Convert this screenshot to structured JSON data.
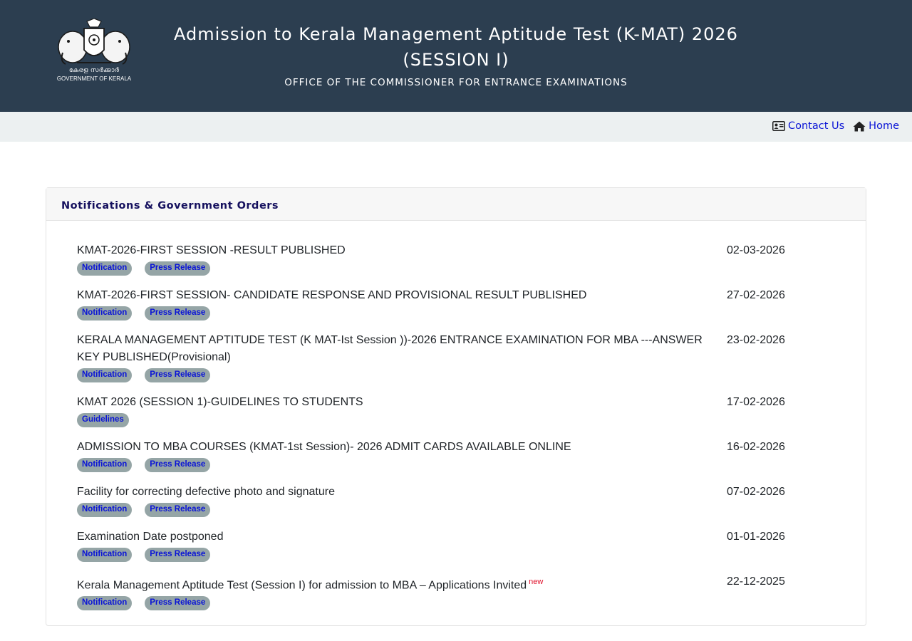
{
  "header": {
    "logo_text_ml": "കേരള സർക്കാർ",
    "logo_text_en": "GOVERNMENT OF KERALA",
    "title_line1": "Admission to Kerala Management Aptitude Test (K-MAT) 2026",
    "title_line2": "(SESSION I)",
    "subtitle": "OFFICE OF THE COMMISSIONER FOR ENTRANCE EXAMINATIONS"
  },
  "nav": {
    "contact_label": "Contact Us",
    "home_label": "Home"
  },
  "card": {
    "title": "Notifications & Government Orders"
  },
  "notifications": [
    {
      "title": "KMAT-2026-FIRST SESSION -RESULT PUBLISHED",
      "date": "02-03-2026",
      "tags": [
        "Notification",
        "Press Release"
      ],
      "new": ""
    },
    {
      "title": "KMAT-2026-FIRST SESSION- CANDIDATE RESPONSE AND PROVISIONAL RESULT PUBLISHED",
      "date": "27-02-2026",
      "tags": [
        "Notification",
        "Press Release"
      ],
      "new": ""
    },
    {
      "title": "KERALA MANAGEMENT APTITUDE TEST (K MAT-Ist Session ))-2026 ENTRANCE EXAMINATION FOR MBA ---ANSWER KEY PUBLISHED(Provisional)",
      "date": "23-02-2026",
      "tags": [
        "Notification",
        "Press Release"
      ],
      "new": ""
    },
    {
      "title": "KMAT 2026 (SESSION 1)-GUIDELINES TO STUDENTS",
      "date": "17-02-2026",
      "tags": [
        "Guidelines"
      ],
      "new": ""
    },
    {
      "title": "ADMISSION TO MBA COURSES (KMAT-1st Session)- 2026 ADMIT CARDS AVAILABLE ONLINE",
      "date": "16-02-2026",
      "tags": [
        "Notification",
        "Press Release"
      ],
      "new": ""
    },
    {
      "title": "Facility for correcting defective photo and signature",
      "date": "07-02-2026",
      "tags": [
        "Notification",
        "Press Release"
      ],
      "new": ""
    },
    {
      "title": "Examination Date postponed",
      "date": "01-01-2026",
      "tags": [
        "Notification",
        "Press Release"
      ],
      "new": ""
    },
    {
      "title": "Kerala Management Aptitude Test (Session I) for admission to MBA – Applications Invited",
      "date": "22-12-2025",
      "tags": [
        "Notification",
        "Press Release"
      ],
      "new": "new"
    }
  ],
  "colors": {
    "header_bg": "#2c3e50",
    "navbar_bg": "#ecf0f1",
    "link": "#0a14d6",
    "tag_bg": "#95a5a6",
    "new_tag": "#e0102a",
    "card_title": "#15105e"
  },
  "icons": {
    "logo": "kerala-emblem-icon",
    "contact": "id-card-icon",
    "home": "home-icon"
  }
}
